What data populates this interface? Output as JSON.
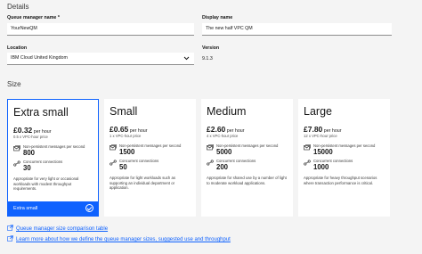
{
  "details": {
    "title": "Details",
    "queue_manager_name": {
      "label": "Queue manager name *",
      "value": "YourNewQM"
    },
    "display_name": {
      "label": "Display name",
      "value": "The new half VPC QM"
    },
    "location": {
      "label": "Location",
      "value": "IBM Cloud United Kingdom"
    },
    "version": {
      "label": "Version",
      "value": "9.1.3"
    }
  },
  "size": {
    "title": "Size",
    "cards": [
      {
        "name": "Extra small",
        "price": "£0.32",
        "price_unit": " per hour",
        "vpc": "0.5 x VPC-hour price",
        "metric1_label": "Non-persistent messages per second",
        "metric1_value": "800",
        "metric2_label": "Concurrent connections",
        "metric2_value": "30",
        "description": "Appropriate for very light or occasional workloads with modest throughput requirements.",
        "footer": "Extra small",
        "selected": true
      },
      {
        "name": "Small",
        "price": "£0.65",
        "price_unit": " per hour",
        "vpc": "1 x VPC-hour price",
        "metric1_label": "Non-persistent messages per second",
        "metric1_value": "1500",
        "metric2_label": "Concurrent connections",
        "metric2_value": "50",
        "description": "Appropriate for light workloads such as supporting an individual department or application."
      },
      {
        "name": "Medium",
        "price": "£2.60",
        "price_unit": " per hour",
        "vpc": "4 x VPC-hour price",
        "metric1_label": "Non-persistent messages per second",
        "metric1_value": "5000",
        "metric2_label": "Concurrent connections",
        "metric2_value": "200",
        "description": "Appropriate for shared use by a number of light to moderate workload applications."
      },
      {
        "name": "Large",
        "price": "£7.80",
        "price_unit": " per hour",
        "vpc": "12 x VPC-hour price",
        "metric1_label": "Non-persistent messages per second",
        "metric1_value": "15000",
        "metric2_label": "Concurrent connections",
        "metric2_value": "1000",
        "description": "Appropriate for heavy throughput scenarios where transaction performance is critical."
      }
    ]
  },
  "links": {
    "comparison": "Queue manager size comparison table",
    "learn_more": "Learn more about how we define the queue manager sizes, suggested use and throughput"
  },
  "icons": {
    "messages": "envelope-stack-icon",
    "connections": "connection-icon",
    "selected": "checkmark-icon",
    "dropdown": "chevron-down-icon",
    "link": "launch-icon"
  },
  "colors": {
    "accent": "#0f62fe",
    "background": "#f4f4f4",
    "card": "#ffffff"
  }
}
